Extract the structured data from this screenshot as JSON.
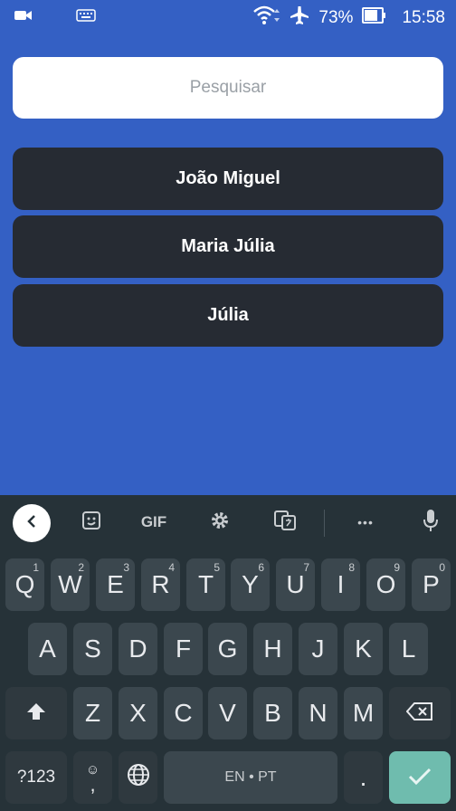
{
  "status_bar": {
    "battery": "73%",
    "time": "15:58"
  },
  "search": {
    "placeholder": "Pesquisar",
    "value": ""
  },
  "list": [
    "João Miguel",
    "Maria Júlia",
    "Júlia"
  ],
  "keyboard": {
    "toolbar": {
      "gif": "GIF",
      "more": "•••"
    },
    "row1": [
      {
        "key": "Q",
        "hint": "1"
      },
      {
        "key": "W",
        "hint": "2"
      },
      {
        "key": "E",
        "hint": "3"
      },
      {
        "key": "R",
        "hint": "4"
      },
      {
        "key": "T",
        "hint": "5"
      },
      {
        "key": "Y",
        "hint": "6"
      },
      {
        "key": "U",
        "hint": "7"
      },
      {
        "key": "I",
        "hint": "8"
      },
      {
        "key": "O",
        "hint": "9"
      },
      {
        "key": "P",
        "hint": "0"
      }
    ],
    "row2": [
      "A",
      "S",
      "D",
      "F",
      "G",
      "H",
      "J",
      "K",
      "L"
    ],
    "row3": [
      "Z",
      "X",
      "C",
      "V",
      "B",
      "N",
      "M"
    ],
    "symbols": "?123",
    "comma": ",",
    "space": "EN • PT",
    "period": "."
  }
}
